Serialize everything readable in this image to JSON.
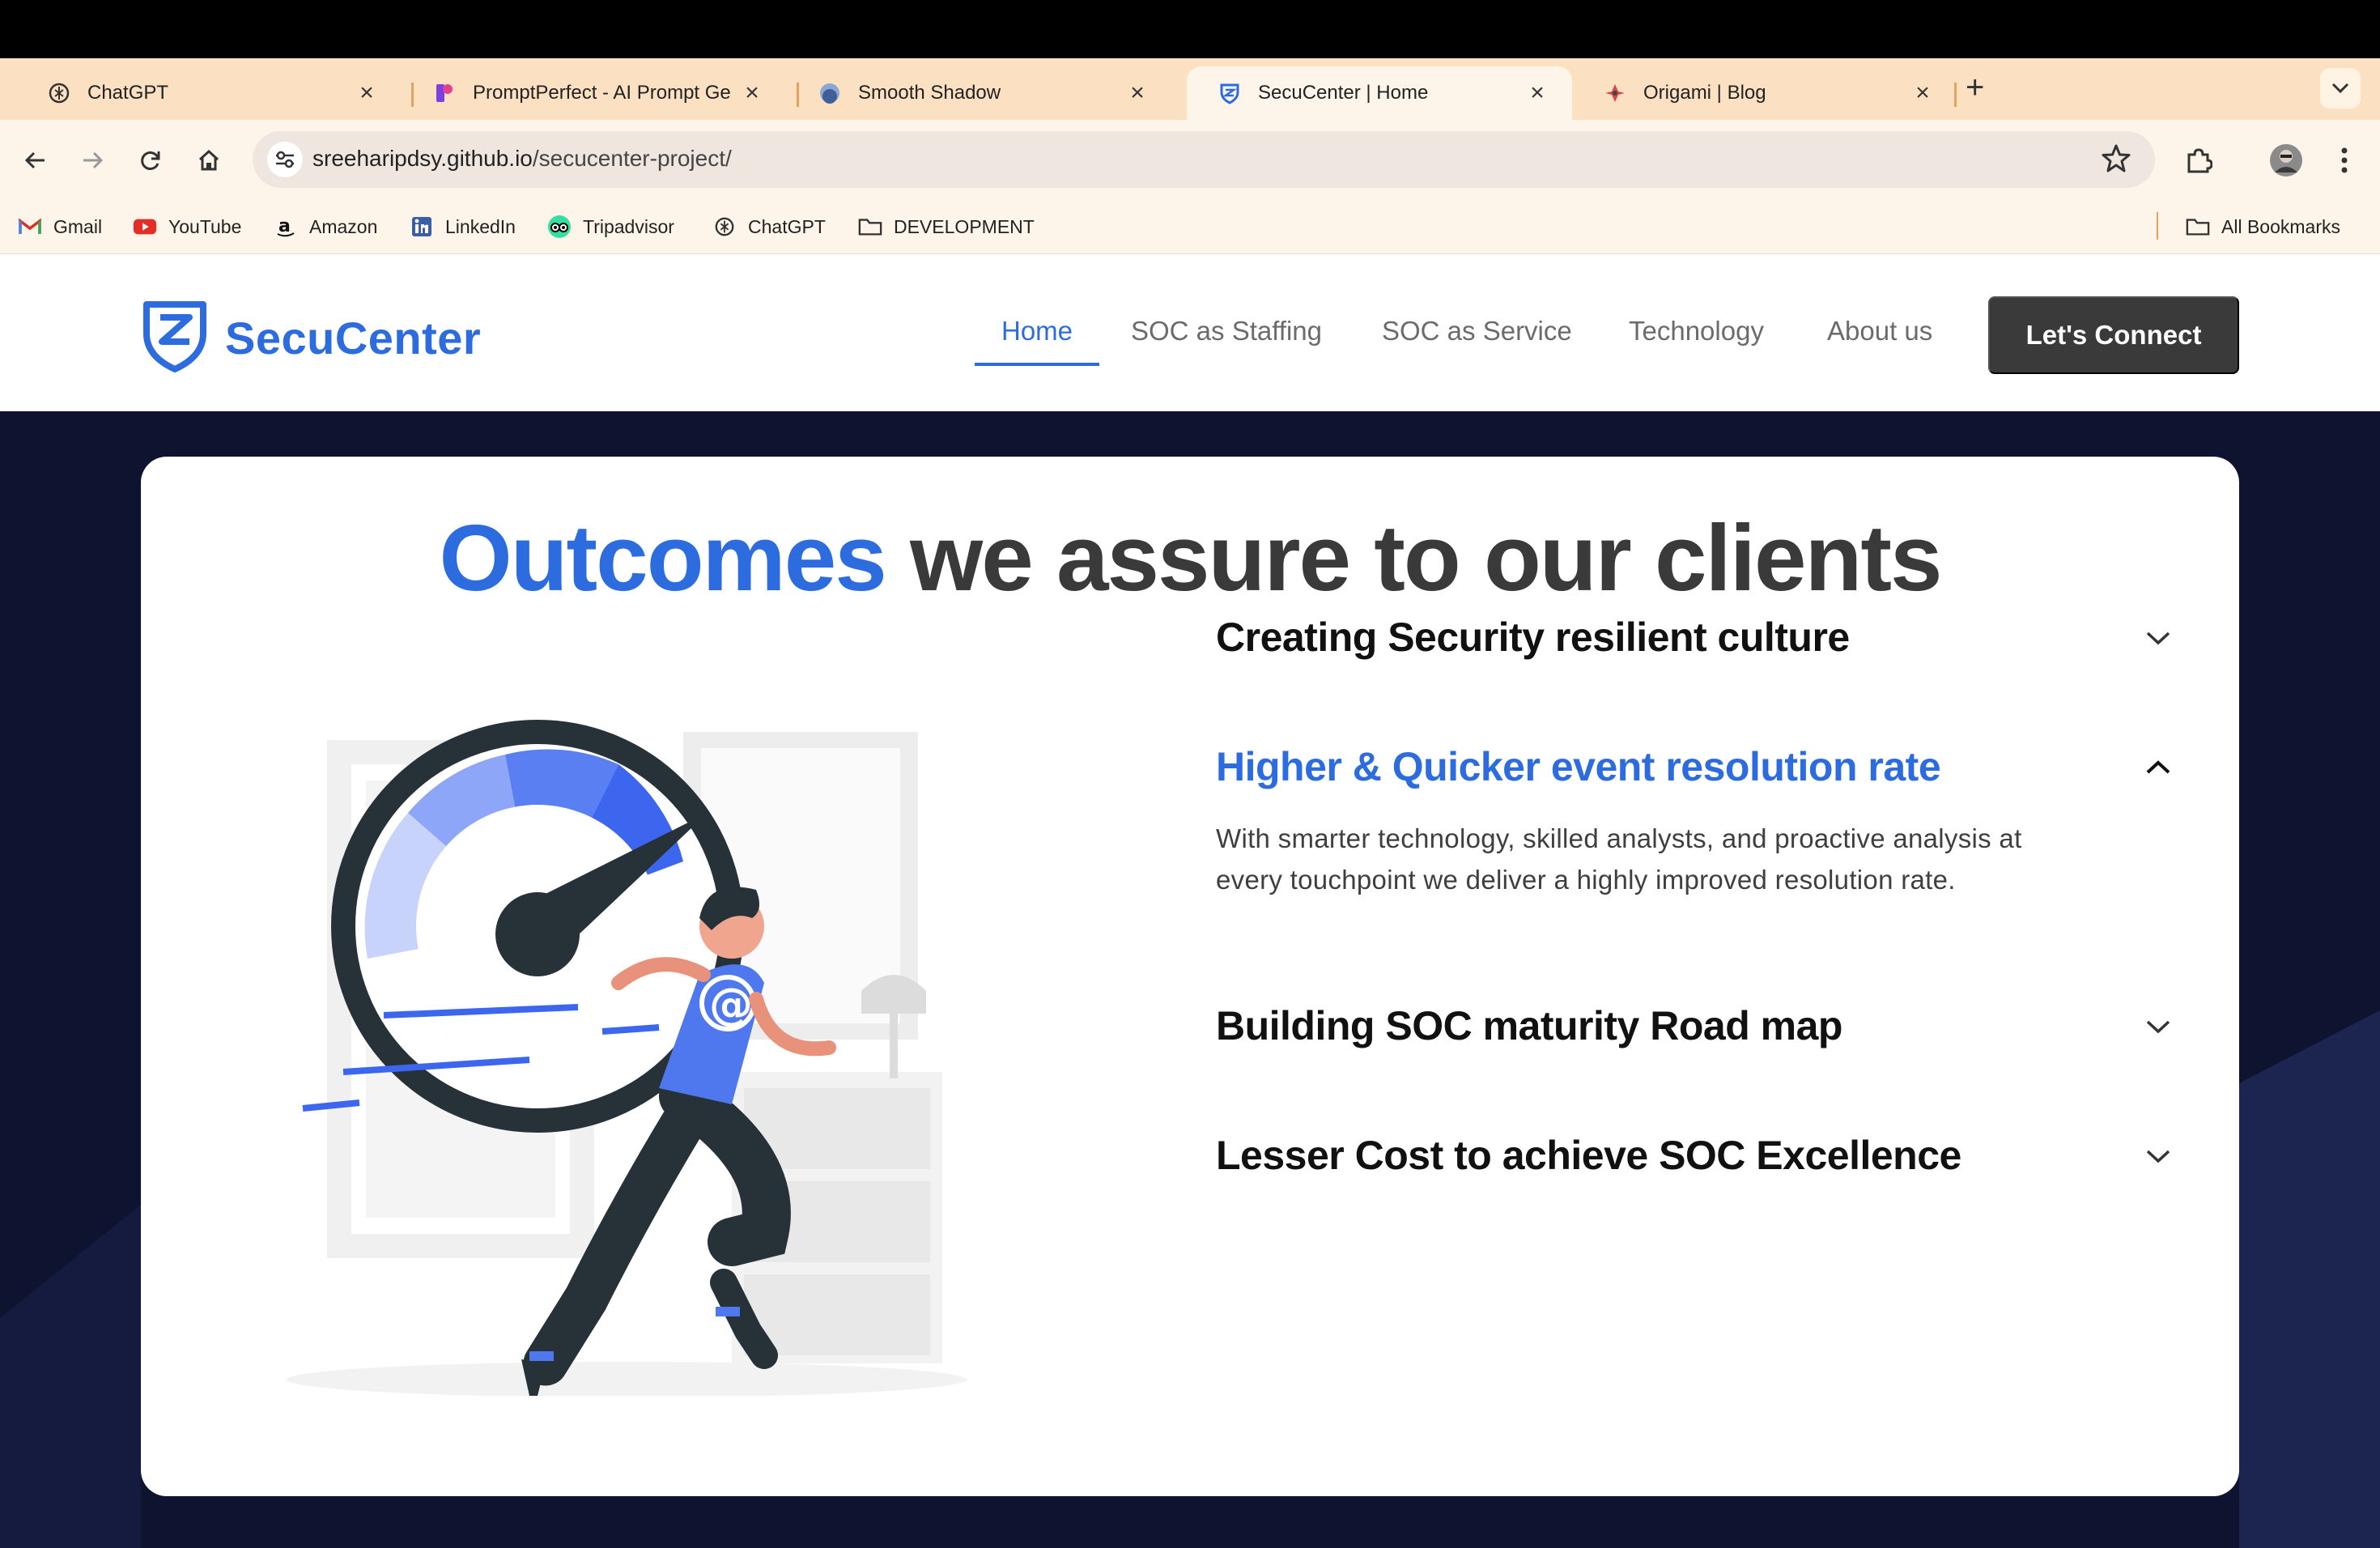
{
  "browser": {
    "tabs": [
      {
        "title": "ChatGPT",
        "icon": "chatgpt-icon",
        "active": false
      },
      {
        "title": "PromptPerfect - AI Prompt Ge",
        "icon": "promptperfect-icon",
        "active": false
      },
      {
        "title": "Smooth Shadow",
        "icon": "smooth-shadow-icon",
        "active": false
      },
      {
        "title": "SecuCenter | Home",
        "icon": "secucenter-icon",
        "active": true
      },
      {
        "title": "Origami | Blog",
        "icon": "origami-icon",
        "active": false
      }
    ],
    "url_host": "sreeharipdsy.github.io",
    "url_path": "/secucenter-project/",
    "bookmarks": [
      {
        "label": "Gmail",
        "icon": "gmail-icon"
      },
      {
        "label": "YouTube",
        "icon": "youtube-icon"
      },
      {
        "label": "Amazon",
        "icon": "amazon-icon"
      },
      {
        "label": "LinkedIn",
        "icon": "linkedin-icon"
      },
      {
        "label": "Tripadvisor",
        "icon": "tripadvisor-icon"
      },
      {
        "label": "ChatGPT",
        "icon": "chatgpt-icon"
      },
      {
        "label": "DEVELOPMENT",
        "icon": "folder-icon"
      }
    ],
    "all_bookmarks": "All Bookmarks"
  },
  "site": {
    "brand": "SecuCenter",
    "nav": [
      {
        "label": "Home",
        "active": true
      },
      {
        "label": "SOC as Staffing",
        "active": false
      },
      {
        "label": "SOC as Service",
        "active": false
      },
      {
        "label": "Technology",
        "active": false
      },
      {
        "label": "About us",
        "active": false
      }
    ],
    "cta": "Let's Connect",
    "colors": {
      "accent": "#2c6cdf",
      "dark": "#3a3a3a",
      "navy": "#0e1430"
    }
  },
  "outcomes": {
    "heading_accent": "Outcomes",
    "heading_rest": "we assure to our clients",
    "items": [
      {
        "title": "Creating Security resilient culture",
        "open": false,
        "body": ""
      },
      {
        "title": "Higher & Quicker event resolution rate",
        "open": true,
        "body": "With smarter technology, skilled analysts, and proactive analysis at every touchpoint we deliver a highly improved resolution rate."
      },
      {
        "title": "Building SOC maturity Road map",
        "open": false,
        "body": ""
      },
      {
        "title": "Lesser Cost to achieve SOC Excellence",
        "open": false,
        "body": ""
      }
    ],
    "illustration_badge": "@"
  }
}
